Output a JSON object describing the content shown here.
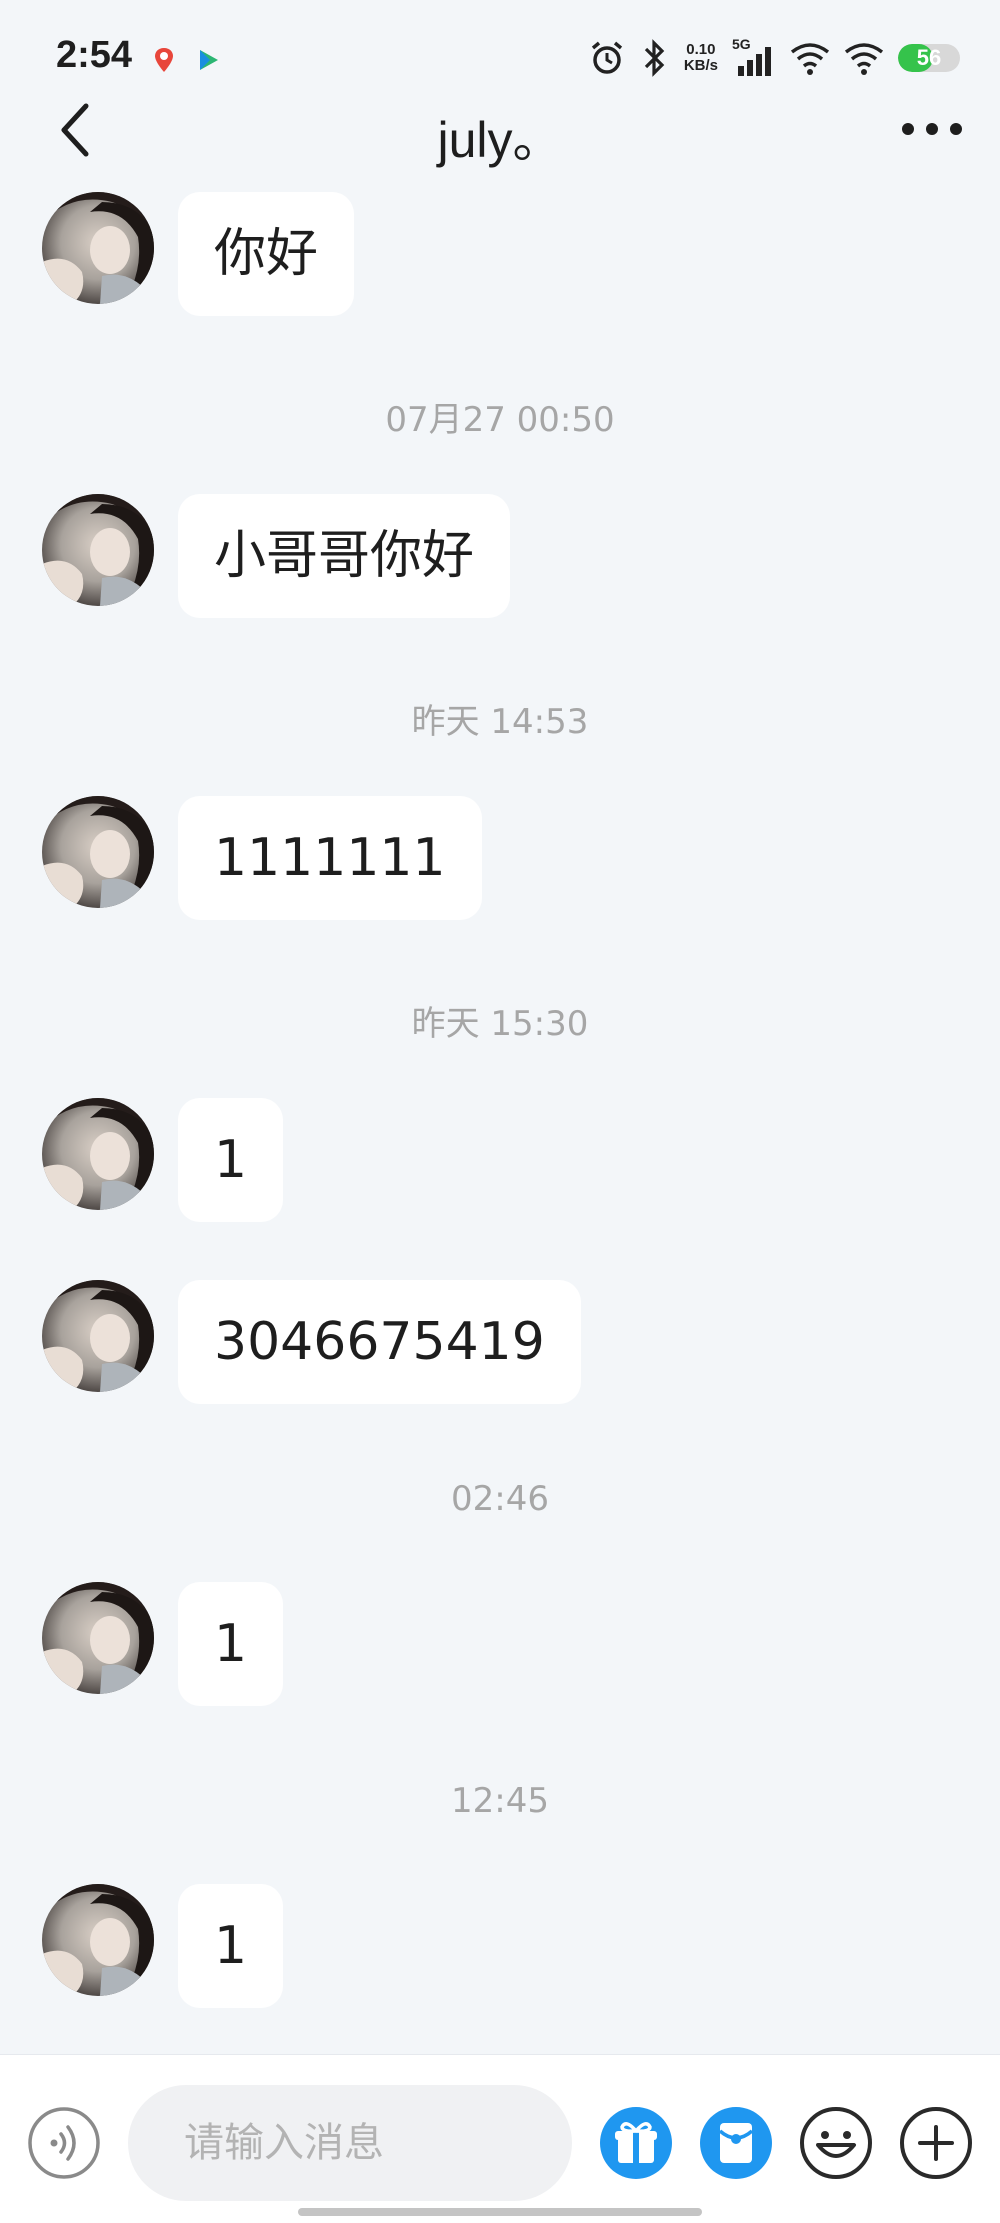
{
  "status_bar": {
    "time": "2:54",
    "net_speed_value": "0.10",
    "net_speed_unit": "KB/s",
    "network_type": "5G",
    "battery_level": "56",
    "battery_fraction": 0.56
  },
  "header": {
    "title": "july。"
  },
  "messages": [
    {
      "text": "你好"
    },
    {
      "text": "小哥哥你好"
    },
    {
      "text": "1111111"
    },
    {
      "text": "1"
    },
    {
      "text": "3046675419"
    },
    {
      "text": "1"
    },
    {
      "text": "1"
    }
  ],
  "timestamps": [
    "07月27 00:50",
    "昨天 14:53",
    "昨天 15:30",
    "02:46",
    "12:45"
  ],
  "composer": {
    "placeholder": "请输入消息"
  },
  "icons": {
    "back": "chevron-left-icon",
    "more": "more-dots-icon",
    "voice": "voice-icon",
    "gift": "gift-icon",
    "red_packet": "red-packet-icon",
    "emoji": "emoji-icon",
    "add": "plus-icon"
  },
  "colors": {
    "accent_blue": "#1f97f0",
    "battery_green": "#35c34b",
    "background": "#f3f6f9"
  }
}
